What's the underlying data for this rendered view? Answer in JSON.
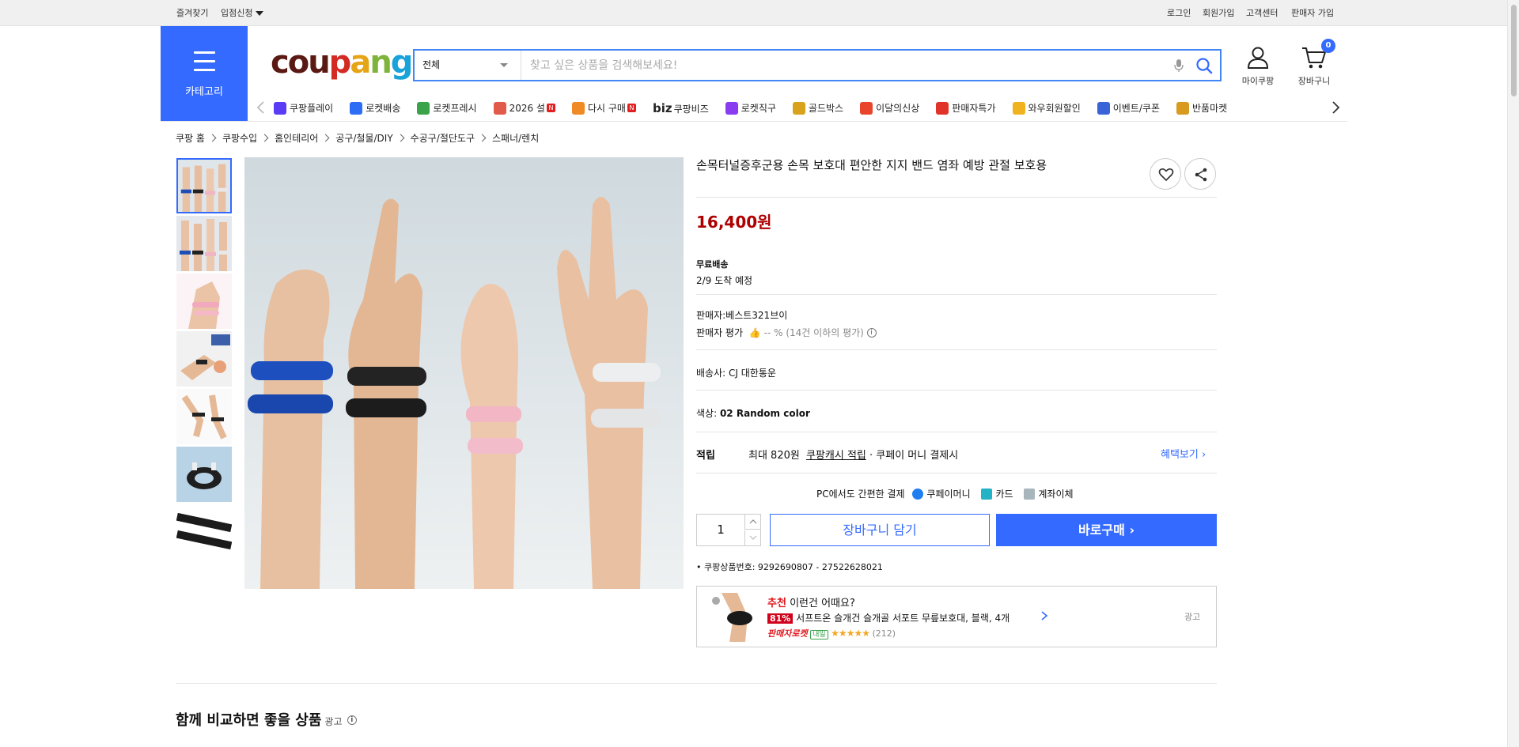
{
  "topbar": {
    "left": [
      "즐겨찾기",
      "입점신청"
    ],
    "right": [
      "로그인",
      "회원가입",
      "고객센터",
      "판매자 가입"
    ]
  },
  "header": {
    "category_label": "카테고리",
    "logo": [
      "cou",
      "p",
      "a",
      "n",
      "g"
    ],
    "search": {
      "category": "전체",
      "placeholder": "찾고 싶은 상품을 검색해보세요!"
    },
    "mycoupang_label": "마이쿠팡",
    "cart_label": "장바구니",
    "cart_count": "0"
  },
  "nav": [
    {
      "label": "쿠팡플레이",
      "icon": "play-icon",
      "color": "#5b3cf5"
    },
    {
      "label": "로켓배송",
      "icon": "rocket-icon",
      "color": "#2d6df6"
    },
    {
      "label": "로켓프레시",
      "icon": "rocket-fresh-icon",
      "color": "#3aa34a"
    },
    {
      "label": "2026 설",
      "icon": "gift-icon",
      "color": "#e25b4a",
      "badge": "N"
    },
    {
      "label": "다시 구매",
      "icon": "home-icon",
      "color": "#f08a24",
      "badge": "N"
    },
    {
      "label": "쿠팡비즈",
      "biz": "biz",
      "icon": "",
      "color": ""
    },
    {
      "label": "로켓직구",
      "icon": "global-icon",
      "color": "#8a3cf0"
    },
    {
      "label": "골드박스",
      "icon": "goldbox-icon",
      "color": "#d9a21c"
    },
    {
      "label": "이달의신상",
      "icon": "new-icon",
      "color": "#e8452c"
    },
    {
      "label": "판매자특가",
      "icon": "percent-icon",
      "color": "#e0342a"
    },
    {
      "label": "와우회원할인",
      "icon": "wow-icon",
      "color": "#f0b31f"
    },
    {
      "label": "이벤트/쿠폰",
      "icon": "coupon-icon",
      "color": "#3a63d8"
    },
    {
      "label": "반품마켓",
      "icon": "market-icon",
      "color": "#d99a20"
    }
  ],
  "breadcrumb": [
    "쿠팡 홈",
    "쿠팡수입",
    "홈인테리어",
    "공구/철물/DIY",
    "수공구/절단도구",
    "스패너/렌치"
  ],
  "product": {
    "title": "손목터널증후군용 손목 보호대 편안한 지지 밴드 염좌 예방 관절 보호용",
    "price": "16,400원",
    "shipping_title": "무료배송",
    "arrival": "2/9 도착 예정",
    "seller": "판매자:베스트321브이",
    "seller_rating_label": "판매자 평가",
    "seller_rating_value": "-- %",
    "seller_rating_note": "(14건 이하의 평가)",
    "carrier_label": "배송사:",
    "carrier": "CJ 대한통운",
    "color_label": "색상:",
    "color_value": "02 Random color",
    "reward_label": "적립",
    "reward_prefix": "최대 820원",
    "reward_link": "쿠팡캐시 적립",
    "reward_suffix": "· 쿠페이 머니 결제시",
    "benefit_link": "혜택보기",
    "pay_title": "PC에서도 간편한 결제",
    "pay_methods": [
      "쿠페이머니",
      "카드",
      "계좌이체"
    ],
    "quantity": "1",
    "add_to_cart": "장바구니 담기",
    "buy_now": "바로구매",
    "product_no": "쿠팡상품번호: 9292690807 - 27522628021"
  },
  "recommend": {
    "tag": "추천",
    "headline": "이런건 어때요?",
    "discount": "81%",
    "name": "서프트온 슬개건 슬개골 서포트 무릎보호대, 블랙, 4개",
    "rocket": "판매자로켓",
    "tomorrow": "내일",
    "stars": "★★★★★",
    "reviews": "(212)",
    "ad": "광고"
  },
  "section": {
    "title": "함께 비교하면 좋을 상품",
    "ad": "광고"
  },
  "colors": {
    "accent": "#346aff",
    "price": "#ae0000"
  }
}
